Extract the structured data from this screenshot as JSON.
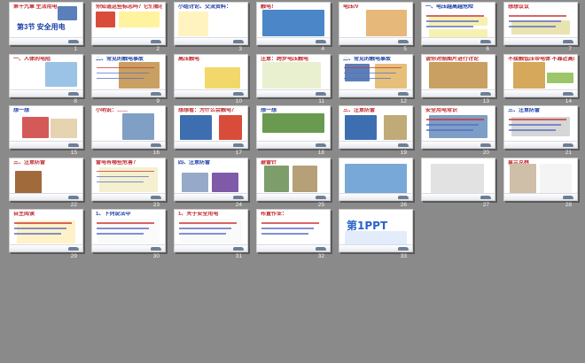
{
  "slides": [
    {
      "n": "1",
      "title": "第十九章 生活用电",
      "heading": "第3节 安全用电"
    },
    {
      "n": "2",
      "title": "你知道这些标志吗？它们都在提醒我们注意什么？"
    },
    {
      "n": "3",
      "title": "小组讨论、交流资料："
    },
    {
      "n": "4",
      "title": "触电！"
    },
    {
      "n": "5",
      "title": "电压/V"
    },
    {
      "n": "6",
      "title": "一、电压越高越危险"
    },
    {
      "n": "7",
      "title": "想想议议"
    },
    {
      "n": "8",
      "title": "一、人体的电阻"
    },
    {
      "n": "9",
      "title": "二、常见的触电事故"
    },
    {
      "n": "10",
      "title": "高压触电"
    },
    {
      "n": "11",
      "title": "注意：跨步电压触电"
    },
    {
      "n": "12",
      "title": "二、常见的触电事故"
    },
    {
      "n": "13",
      "title": "请你对照图片进行讨论"
    },
    {
      "n": "14",
      "title": "不接触低压带电体 不靠近高压带电体"
    },
    {
      "n": "15",
      "title": "想一想"
    },
    {
      "n": "16",
      "title": "小明说：……"
    },
    {
      "n": "17",
      "title": "想想看：为什么会触电？"
    },
    {
      "n": "18",
      "title": "想一想"
    },
    {
      "n": "19",
      "title": "三、注意防雷"
    },
    {
      "n": "20",
      "title": "安全用电常识"
    },
    {
      "n": "21",
      "title": "三、注意防雷"
    },
    {
      "n": "22",
      "title": "三、注意防雷"
    },
    {
      "n": "23",
      "title": "雷电有哪些危害？"
    },
    {
      "n": "24",
      "title": "四、注意防雷"
    },
    {
      "n": "25",
      "title": "避雷针"
    },
    {
      "n": "26",
      "title": ""
    },
    {
      "n": "27",
      "title": ""
    },
    {
      "n": "28",
      "title": "富兰克林"
    },
    {
      "n": "29",
      "title": "自主阅读"
    },
    {
      "n": "30",
      "title": "1、下列说法中"
    },
    {
      "n": "31",
      "title": "1、关于安全用电"
    },
    {
      "n": "32",
      "title": "布置作业："
    },
    {
      "n": "33",
      "title": "第1PPT",
      "logo": "第1PPT"
    }
  ],
  "colors": {
    "bg": "#8a8a8a",
    "slide": "#ffffff",
    "accent_red": "#c0282d",
    "accent_blue": "#1a3ea8"
  }
}
